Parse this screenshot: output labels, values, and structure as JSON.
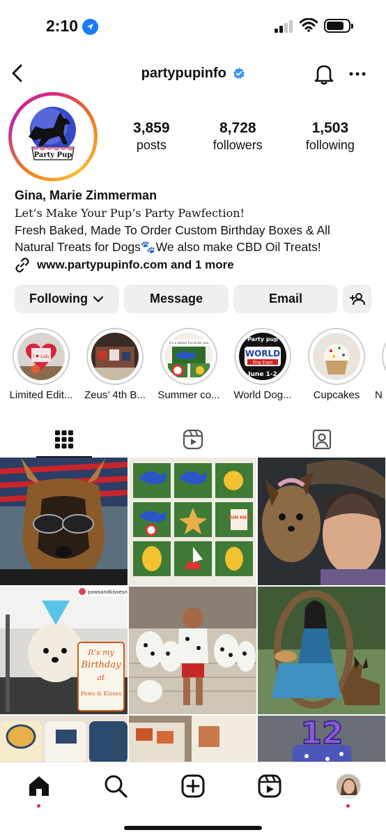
{
  "status_bar": {
    "time": "2:10"
  },
  "header": {
    "username": "partypupinfo"
  },
  "profile": {
    "avatar_text": "Party Pup",
    "stats": [
      {
        "value": "3,859",
        "label": "posts"
      },
      {
        "value": "8,728",
        "label": "followers"
      },
      {
        "value": "1,503",
        "label": "following"
      }
    ],
    "name": "Gina, Marie Zimmerman",
    "tagline": "Let’s Make Your Pup’s Party Pawfection!",
    "bio_line1": "Fresh Baked, Made To Order Custom Birthday Boxes & All",
    "bio_line2": "Natural Treats for Dogs🐾We also make CBD Oil Treats!",
    "link": "www.partypupinfo.com and 1 more"
  },
  "actions": {
    "following": "Following",
    "message": "Message",
    "email": "Email"
  },
  "highlights": [
    {
      "label": "Limited Edit...",
      "badge": "I ♥ Lulu"
    },
    {
      "label": "Zeus’ 4th B..."
    },
    {
      "label": "Summer co...",
      "badge": "It's a whale fun to be you"
    },
    {
      "label": "World Dog...",
      "badge_top": "Party pup",
      "badge_mid": "WORLD",
      "badge_sub": "Dog Expo",
      "badge_bottom": "June 1-2"
    },
    {
      "label": "Cupcakes"
    },
    {
      "label": "N"
    }
  ],
  "grid": {
    "watermark": "pawsandkissesnj",
    "birthday_sign": [
      "It's my",
      "Birthday",
      "at",
      "Paws & Kisses"
    ],
    "cookie_summer": "SUM MER",
    "cake_number": "12"
  },
  "colors": {
    "accent_blue": "#1a7df7",
    "verified_blue": "#3897f0",
    "button_bg": "#efefef",
    "notification_dot": "#e0245e"
  }
}
